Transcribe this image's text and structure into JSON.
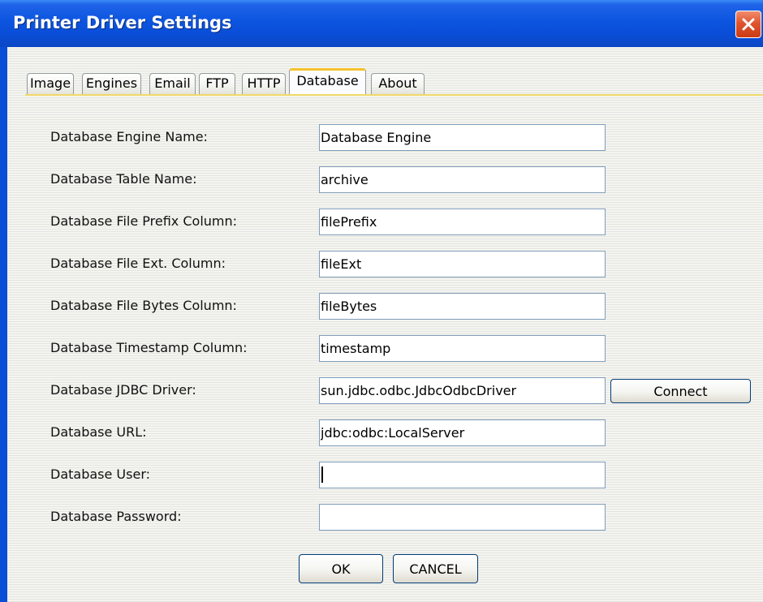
{
  "window": {
    "title": "Printer Driver Settings"
  },
  "tabs": [
    {
      "label": "Image",
      "active": false
    },
    {
      "label": "Engines",
      "active": false
    },
    {
      "label": "Email",
      "active": false
    },
    {
      "label": "FTP",
      "active": false
    },
    {
      "label": "HTTP",
      "active": false
    },
    {
      "label": "Database",
      "active": true
    },
    {
      "label": "About",
      "active": false
    }
  ],
  "form": {
    "engine_name": {
      "label": "Database Engine Name:",
      "value": "Database Engine"
    },
    "table_name": {
      "label": "Database Table Name:",
      "value": "archive"
    },
    "file_prefix": {
      "label": "Database File Prefix Column:",
      "value": "filePrefix"
    },
    "file_ext": {
      "label": "Database File Ext. Column:",
      "value": "fileExt"
    },
    "file_bytes": {
      "label": "Database File Bytes Column:",
      "value": "fileBytes"
    },
    "timestamp": {
      "label": "Database Timestamp Column:",
      "value": "timestamp"
    },
    "jdbc_driver": {
      "label": "Database JDBC Driver:",
      "value": "sun.jdbc.odbc.JdbcOdbcDriver"
    },
    "url": {
      "label": "Database URL:",
      "value": "jdbc:odbc:LocalServer"
    },
    "user": {
      "label": "Database User:",
      "value": ""
    },
    "password": {
      "label": "Database Password:",
      "value": ""
    }
  },
  "buttons": {
    "connect": "Connect",
    "ok": "OK",
    "cancel": "CANCEL"
  },
  "colors": {
    "titlebar": "#0a4ed8",
    "active_tab_accent": "#f5c22d",
    "close_button": "#e0552f"
  }
}
